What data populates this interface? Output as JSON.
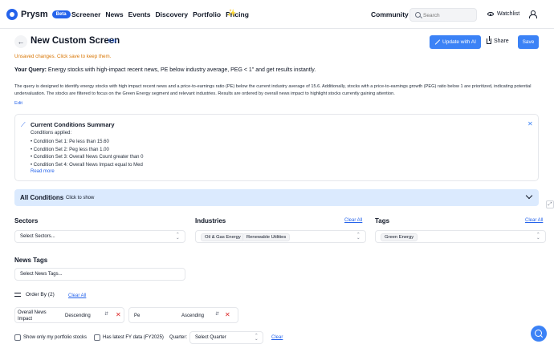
{
  "nav": {
    "brand": "Prysm",
    "badge": "Beta",
    "links": [
      "Screener",
      "News",
      "Events",
      "Discovery",
      "Portfolio",
      "Pricing"
    ],
    "community": "Community",
    "search_placeholder": "Search",
    "watchlist": "Watchlist"
  },
  "header": {
    "title": "New Custom Screen",
    "edit": "Edit",
    "update_ai": "Update with AI",
    "share": "Share",
    "save": "Save"
  },
  "unsaved": "Unsaved changes. Click save to keep them.",
  "query": {
    "label": "Your Query:",
    "text": "Energy stocks with high-impact recent news, PE below industry average, PEG < 1\" and get results instantly."
  },
  "description": "The query is designed to identify energy stocks with high impact recent news and a price-to-earnings ratio (PE) below the current industry average of 15.6. Additionally, stocks with a price-to-earnings growth (PEG) ratio below 1 are prioritized, indicating potential undervaluation. The stocks are filtered to focus on the Green Energy segment and relevant industries. Results are ordered by overall news impact to highlight stocks currently gaining attention.",
  "description_edit": "Edit",
  "summary": {
    "title": "Current Conditions Summary",
    "label": "Conditions applied:",
    "conditions": [
      "• Condition Set 1: Pe less than 15.60",
      "• Condition Set 2: Peg less than 1.00",
      "• Condition Set 3: Overall News Count greater than 0",
      "• Condition Set 4: Overall News Impact equal to Med"
    ],
    "read_more": "Read more"
  },
  "all_conditions": {
    "title": "All Conditions",
    "subtitle": "Click to show"
  },
  "filters": {
    "sectors": {
      "label": "Sectors",
      "placeholder": "Select Sectors..."
    },
    "industries": {
      "label": "Industries",
      "clear": "Clear All",
      "chips": [
        "Oil & Gas Energy",
        "Renewable Utilities"
      ]
    },
    "tags": {
      "label": "Tags",
      "clear": "Clear All",
      "chips": [
        "Green Energy"
      ]
    },
    "news_tags": {
      "label": "News Tags",
      "placeholder": "Select News Tags..."
    }
  },
  "order": {
    "label": "Order By (2)",
    "clear": "Clear All",
    "rows": [
      {
        "field_line1": "Overall News",
        "field_line2": "Impact",
        "direction": "Descending"
      },
      {
        "field_line1": "Pe",
        "field_line2": "",
        "direction": "Ascending"
      }
    ]
  },
  "footer": {
    "portfolio_only": "Show only my portfolio stocks",
    "latest_fy": "Has latest FY data (FY2025)",
    "quarter_label": "Quarter:",
    "quarter_placeholder": "Select Quarter",
    "clear": "Clear"
  },
  "colors": {
    "accent": "#3b82f6",
    "warning": "#d97706",
    "panel": "#dbeafe",
    "remove": "#dc2626"
  }
}
